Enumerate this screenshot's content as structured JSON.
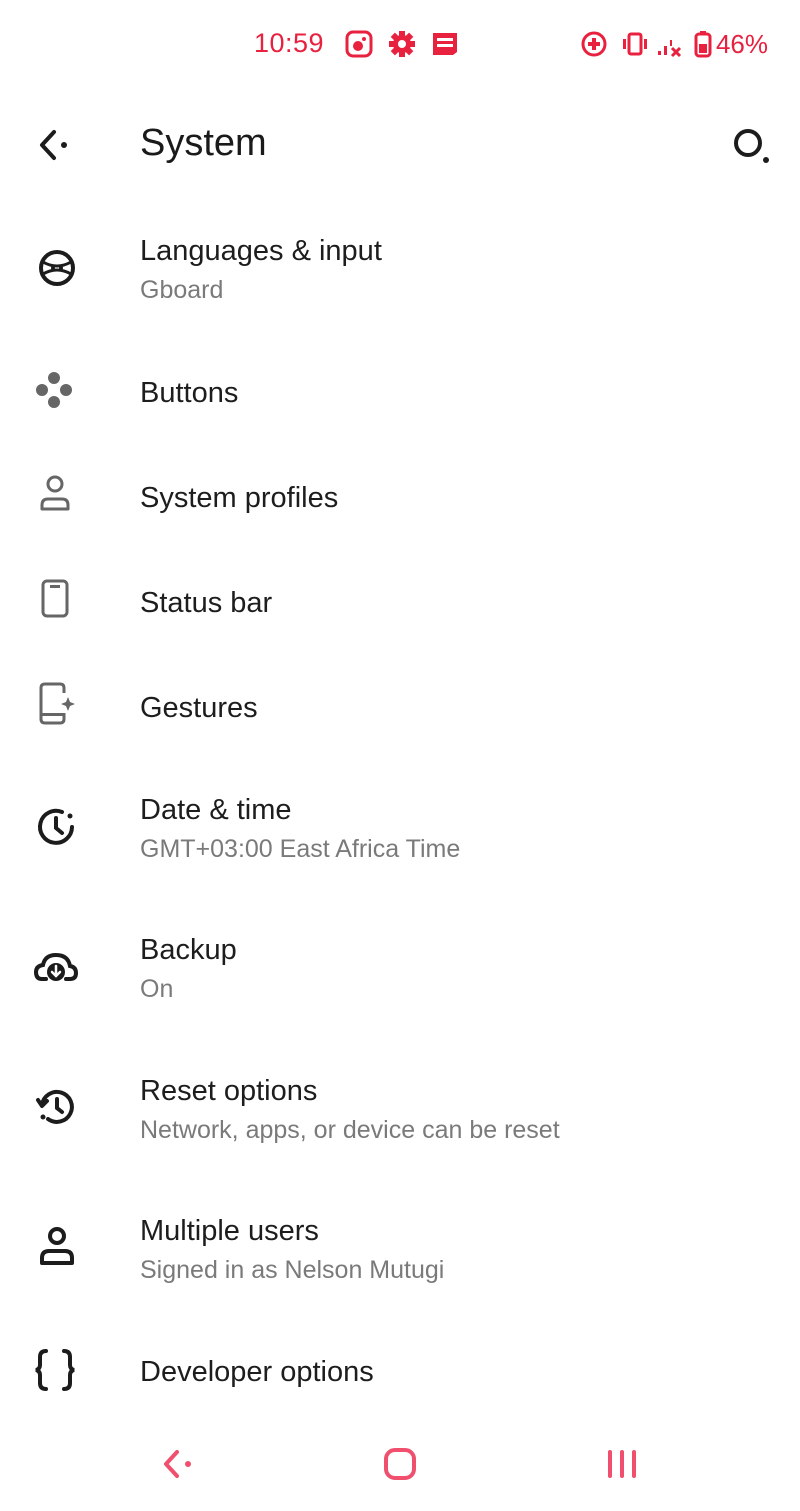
{
  "status_bar": {
    "time": "10:59",
    "battery": "46%",
    "accent_color": "#e8213f",
    "left_icons": [
      "gallery-icon",
      "settings-gear-icon",
      "news-icon"
    ],
    "right_icons": [
      "data-saver-icon",
      "vibrate-icon",
      "no-signal-icon",
      "battery-icon"
    ]
  },
  "header": {
    "title": "System",
    "back_icon": "back-arrow-icon",
    "search_icon": "search-icon"
  },
  "items": [
    {
      "id": "languages",
      "icon": "language-globe-icon",
      "title": "Languages & input",
      "summary": "Gboard"
    },
    {
      "id": "buttons",
      "icon": "gamepad-buttons-icon",
      "title": "Buttons",
      "summary": ""
    },
    {
      "id": "system-profiles",
      "icon": "person-outline-icon",
      "title": "System profiles",
      "summary": ""
    },
    {
      "id": "status-bar",
      "icon": "phone-outline-icon",
      "title": "Status bar",
      "summary": ""
    },
    {
      "id": "gestures",
      "icon": "phone-sparkle-icon",
      "title": "Gestures",
      "summary": ""
    },
    {
      "id": "date-time",
      "icon": "clock-icon",
      "title": "Date & time",
      "summary": "GMT+03:00 East Africa Time"
    },
    {
      "id": "backup",
      "icon": "cloud-backup-icon",
      "title": "Backup",
      "summary": "On"
    },
    {
      "id": "reset",
      "icon": "history-reset-icon",
      "title": "Reset options",
      "summary": "Network, apps, or device can be reset"
    },
    {
      "id": "multiple-users",
      "icon": "user-icon",
      "title": "Multiple users",
      "summary": "Signed in as Nelson Mutugi"
    },
    {
      "id": "developer",
      "icon": "code-braces-icon",
      "title": "Developer options",
      "summary": ""
    }
  ],
  "nav_bar": {
    "back_icon": "nav-back-icon",
    "home_icon": "nav-home-icon",
    "recents_icon": "nav-recents-icon"
  }
}
